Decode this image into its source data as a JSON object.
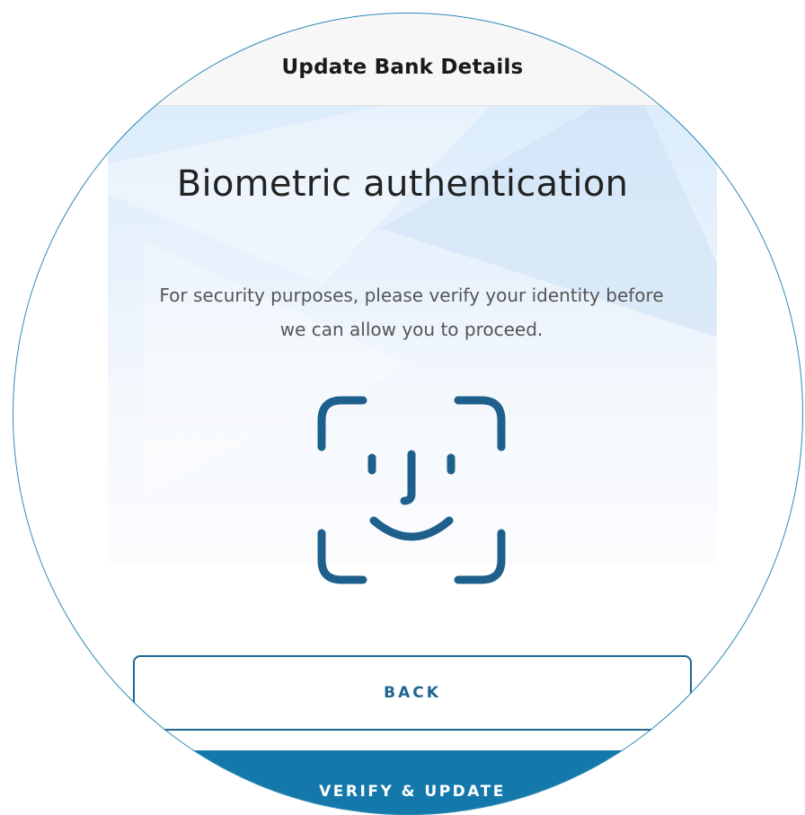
{
  "nav": {
    "title": "Update Bank Details"
  },
  "main": {
    "heading": "Biometric authentication",
    "description": "For security purposes, please verify your identity before we can allow you to proceed.",
    "icon": "face-id-icon"
  },
  "actions": {
    "back_label": "BACK",
    "verify_label": "VERIFY & UPDATE"
  },
  "colors": {
    "accent": "#1e6691",
    "primary_button": "#1479aa",
    "outline": "#2e8bb8",
    "icon": "#1e5f8c"
  }
}
